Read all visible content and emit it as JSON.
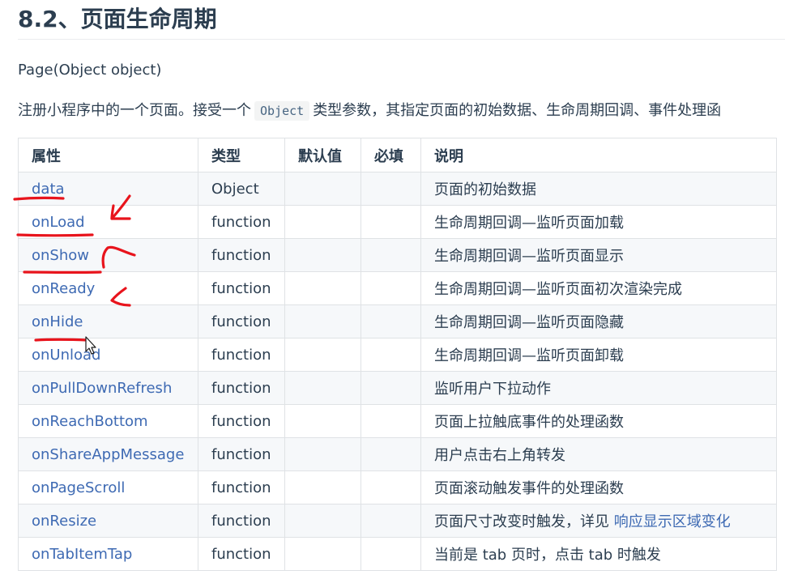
{
  "heading": "8.2、页面生命周期",
  "signature": "Page(Object object)",
  "desc": {
    "before": "注册小程序中的一个页面。接受一个",
    "code": "Object",
    "after": "类型参数，其指定页面的初始数据、生命周期回调、事件处理函"
  },
  "table": {
    "headers": [
      "属性",
      "类型",
      "默认值",
      "必填",
      "说明"
    ],
    "rows": [
      {
        "name": "data",
        "type": "Object",
        "default": "",
        "required": "",
        "desc": "页面的初始数据"
      },
      {
        "name": "onLoad",
        "type": "function",
        "default": "",
        "required": "",
        "desc": "生命周期回调—监听页面加载"
      },
      {
        "name": "onShow",
        "type": "function",
        "default": "",
        "required": "",
        "desc": "生命周期回调—监听页面显示"
      },
      {
        "name": "onReady",
        "type": "function",
        "default": "",
        "required": "",
        "desc": "生命周期回调—监听页面初次渲染完成"
      },
      {
        "name": "onHide",
        "type": "function",
        "default": "",
        "required": "",
        "desc": "生命周期回调—监听页面隐藏"
      },
      {
        "name": "onUnload",
        "type": "function",
        "default": "",
        "required": "",
        "desc": "生命周期回调—监听页面卸载"
      },
      {
        "name": "onPullDownRefresh",
        "type": "function",
        "default": "",
        "required": "",
        "desc": "监听用户下拉动作"
      },
      {
        "name": "onReachBottom",
        "type": "function",
        "default": "",
        "required": "",
        "desc": "页面上拉触底事件的处理函数"
      },
      {
        "name": "onShareAppMessage",
        "type": "function",
        "default": "",
        "required": "",
        "desc": "用户点击右上角转发"
      },
      {
        "name": "onPageScroll",
        "type": "function",
        "default": "",
        "required": "",
        "desc": "页面滚动触发事件的处理函数"
      },
      {
        "name": "onResize",
        "type": "function",
        "default": "",
        "required": "",
        "desc": "页面尺寸改变时触发，详见",
        "link": "响应显示区域变化"
      },
      {
        "name": "onTabItemTap",
        "type": "function",
        "default": "",
        "required": "",
        "desc": "当前是 tab 页时，点击 tab 时触发"
      }
    ]
  },
  "colors": {
    "link": "#3e6ab3",
    "annotation": "#e8141c",
    "text": "#2c3e50",
    "border": "#dfe2e5"
  }
}
